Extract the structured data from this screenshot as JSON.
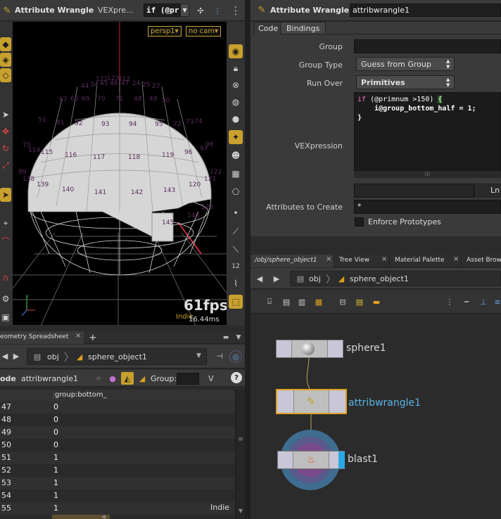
{
  "left_header": {
    "title": "Attribute Wrangle",
    "vex_label": "VEXpre...",
    "vex_value": "if (@pr"
  },
  "viewport": {
    "camera": "persp1▾",
    "cam2": "no cam▾",
    "fps": "61fps",
    "ms": "16.44ms",
    "indie": "Indie",
    "prim_labels": [
      "122",
      "123",
      "112",
      "44",
      "34",
      "45",
      "46",
      "47",
      "24",
      "25",
      "27",
      "67",
      "68",
      "69",
      "70",
      "71",
      "48",
      "49",
      "50",
      "51",
      "91",
      "92",
      "93",
      "94",
      "95",
      "72",
      "73",
      "74",
      "75",
      "114",
      "115",
      "116",
      "117",
      "118",
      "119",
      "96",
      "97",
      "98",
      "99",
      "138",
      "139",
      "140",
      "141",
      "142",
      "143",
      "120",
      "121",
      "122",
      "123",
      "146",
      "145",
      "144"
    ]
  },
  "spreadsheet": {
    "tab": "eometry Spreadsheet",
    "path_obj": "obj",
    "path_node": "sphere_object1",
    "node_label": "ode",
    "node": "attribwrangle1",
    "group_label": "Group:",
    "col_header": "group:bottom_",
    "indie": "Indie",
    "rows": [
      {
        "i": "47",
        "v": "0"
      },
      {
        "i": "48",
        "v": "0"
      },
      {
        "i": "49",
        "v": "0"
      },
      {
        "i": "50",
        "v": "0"
      },
      {
        "i": "51",
        "v": "1"
      },
      {
        "i": "52",
        "v": "1"
      },
      {
        "i": "53",
        "v": "1"
      },
      {
        "i": "54",
        "v": "1"
      },
      {
        "i": "55",
        "v": "1"
      }
    ]
  },
  "params": {
    "node_type": "Attribute Wrangle",
    "node_name": "attribwrangle1",
    "tabs": [
      "Code",
      "Bindings"
    ],
    "group_label": "Group",
    "group_value": "",
    "group_type_label": "Group Type",
    "group_type_value": "Guess from Group",
    "run_over_label": "Run Over",
    "run_over_value": "Primitives",
    "vex_label": "VEXpression",
    "code": [
      "if (@primnum >150) {",
      "    i@group_bottom_half = 1;",
      "}"
    ],
    "ln_label": "Ln",
    "attrs_label": "Attributes to Create",
    "attrs_value": "*",
    "enforce_label": "Enforce Prototypes"
  },
  "network": {
    "tabs": [
      "/obj/sphere_object1",
      "Tree View",
      "Material Palette",
      "Asset Brows"
    ],
    "path_obj": "obj",
    "path_node": "sphere_object1",
    "nodes": {
      "sphere": "sphere1",
      "wrangle": "attribwrangle1",
      "blast": "blast1"
    }
  },
  "colors": {
    "accent": "#c7a02d",
    "selected_node": "#5ab4e6",
    "blast_flag": "#2aa8e6"
  }
}
